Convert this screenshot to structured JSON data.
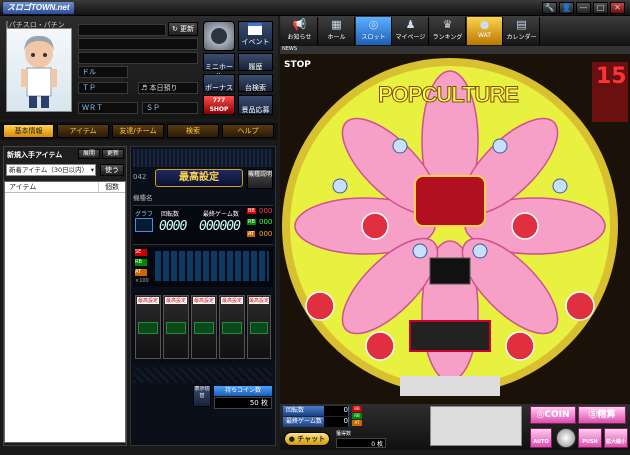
{
  "app": {
    "logo": "スロゴTOWN.net"
  },
  "window_controls": [
    "🔧",
    "👤",
    "—",
    "□",
    "✕"
  ],
  "profile": {
    "name_field": "[パチスロ・パチンコ]",
    "update_button": "更新",
    "labels": {
      "dollar": "ドル",
      "tp": "ＴＰ",
      "wrt": "ＷＲＴ",
      "sp": "ＳＰ"
    },
    "today": "本日預り",
    "nav": [
      {
        "label": "イベント",
        "icon": "calendar-icon"
      },
      {
        "label": "ミニホール",
        "icon": "home-icon"
      },
      {
        "label": "履歴",
        "icon": "list-icon"
      },
      {
        "label": "ボーナス",
        "icon": "plus-icon"
      },
      {
        "label": "台検索",
        "icon": "search-icon"
      },
      {
        "label": "777 SHOP",
        "icon": "shop-icon"
      },
      {
        "label": "景品応募",
        "icon": "gift-icon"
      }
    ]
  },
  "left_tabs": [
    "基本情報",
    "アイテム",
    "友達/チーム",
    "検索",
    "ヘルプ"
  ],
  "items": {
    "title": "新規入手アイテム",
    "buttons": [
      "展開",
      "更新"
    ],
    "filter": "新着アイテム（30日以内）",
    "use": "使う",
    "columns": [
      "アイテム",
      "個数"
    ]
  },
  "center": {
    "number": "042",
    "setting_banner": "最高設定",
    "kind_button": "機種説明",
    "kind_name_label": "機種名",
    "graph_label": "グラフ",
    "spins_label": "回転数",
    "games_label": "最終ゲーム数",
    "spins_value": "0000",
    "games_value": "000000",
    "bb_label": "BB",
    "rb_label": "RB",
    "at_label": "AT",
    "bb_value": "000",
    "rb_value": "000",
    "at_value": "000",
    "scale": [
      "SE",
      "RB",
      "AT",
      "×100"
    ],
    "slots": [
      "最高設定",
      "最高設定",
      "最高設定",
      "最高設定",
      "最高設定"
    ],
    "hold_button": "表示切替",
    "hold_label": "持ちコイン数",
    "coins": "50",
    "coins_unit": "枚"
  },
  "top_nav": [
    {
      "label": "お知らせ",
      "icon": "📢"
    },
    {
      "label": "ホール",
      "icon": "▦"
    },
    {
      "label": "スロット",
      "icon": "◎"
    },
    {
      "label": "マイページ",
      "icon": "♟"
    },
    {
      "label": "ランキング",
      "icon": "♛"
    },
    {
      "label": "WAT",
      "icon": "●"
    },
    {
      "label": "カレンダー",
      "icon": "▤"
    }
  ],
  "game": {
    "title": "POPCULTURE",
    "news": "NEWS",
    "stop": "STOP",
    "counter": "15"
  },
  "footer": {
    "spins_label": "回転数",
    "last_games_label": "最終ゲーム数",
    "spins_value": "0",
    "games_value": "0",
    "bb": "BB",
    "rb": "RB",
    "at": "AT",
    "chat": "チャット",
    "point_label": "獲得数",
    "point_value": "0",
    "point_unit": "枚",
    "coin": "COIN",
    "settle": "精算",
    "auto": "AUTO",
    "push": "PUSH",
    "zoom": "拡大縮小"
  }
}
